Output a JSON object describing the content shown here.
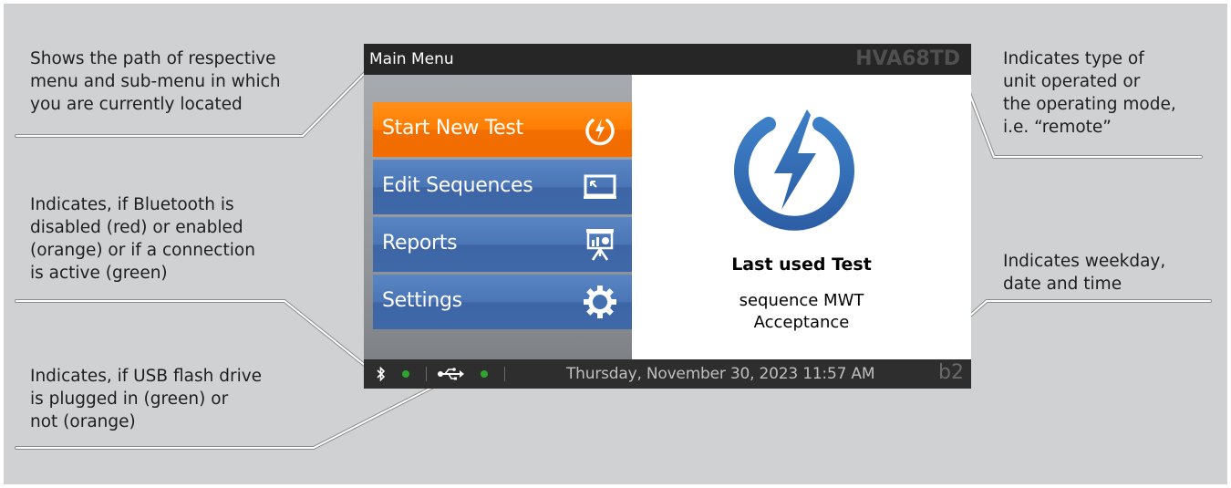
{
  "device": {
    "menu_path": "Main Menu",
    "unit_type": "HVA68TD",
    "menu": [
      {
        "label": "Start New Test",
        "icon": "power-icon",
        "active": true
      },
      {
        "label": "Edit Sequences",
        "icon": "monitor-icon",
        "active": false
      },
      {
        "label": "Reports",
        "icon": "presentation-icon",
        "active": false
      },
      {
        "label": "Settings",
        "icon": "gear-icon",
        "active": false
      }
    ],
    "last_test_title": "Last used Test",
    "last_test_line1": "sequence MWT",
    "last_test_line2": "Acceptance",
    "status": {
      "bluetooth_icon": "bluetooth-icon",
      "usb_icon": "usb-icon",
      "datetime": "Thursday, November 30, 2023 11:57 AM",
      "brand": "b2"
    },
    "colors": {
      "orange": "#ff7d00",
      "blue": "#4a75b6",
      "green_indicator": "#2ea52e"
    }
  },
  "annotations": {
    "path": [
      "Shows the path of respective",
      "menu and sub-menu in which",
      "you are currently located"
    ],
    "unit": [
      "Indicates type of",
      "unit operated or",
      "the operating mode,",
      "i.e. “remote”"
    ],
    "bluetooth": [
      "Indicates, if Bluetooth is",
      "disabled (red) or enabled",
      "(orange) or if a connection",
      "is active (green)"
    ],
    "datetime": [
      "Indicates weekday,",
      "date and time"
    ],
    "usb": [
      "Indicates, if USB flash drive",
      "is plugged in (green) or",
      "not (orange)"
    ]
  }
}
